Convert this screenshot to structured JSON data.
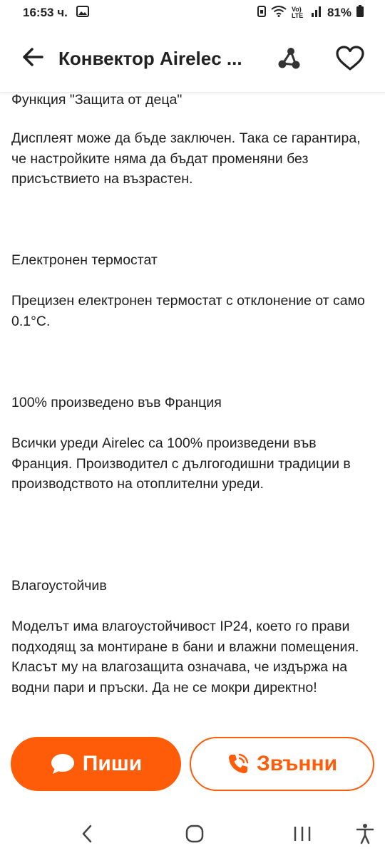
{
  "status_bar": {
    "time": "16:53 ч.",
    "network": "Vo) LTE",
    "battery": "81%"
  },
  "app_bar": {
    "title": "Конвектор Airelec ..."
  },
  "content": {
    "paragraphs": [
      "Функция \"Защита от деца\"",
      "Дисплеят може да бъде заключен. Така се гарантира, че настройките няма да бъдат променяни без присъствието на възрастен.",
      "Електронен термостат",
      "Прецизен електронен термостат с отклонение от само 0.1°C.",
      "100% произведено във Франция",
      "Всички уреди Airelec са 100% произведени във Франция. Производител с дългогодишни традиции в производството на отоплителни уреди.",
      "Влагоустойчив",
      "Моделът има влагоустойчивост IP24, което го прави подходящ за монтиране в бани и влажни помещения. Класът му на влагозащита означава, че издържа на водни пари и пръски. Да не се мокри директно!"
    ]
  },
  "actions": {
    "write_label": "Пиши",
    "call_label": "Звънни"
  },
  "colors": {
    "accent": "#ff5c0a"
  },
  "icons": {
    "back": "arrow-left-icon",
    "share": "share-icon",
    "favorite": "heart-icon",
    "write": "chat-bubble-icon",
    "call": "phone-ringing-icon",
    "nav_back": "chevron-left-icon",
    "nav_home": "home-icon",
    "nav_recents": "recents-icon",
    "accessibility": "accessibility-icon"
  }
}
